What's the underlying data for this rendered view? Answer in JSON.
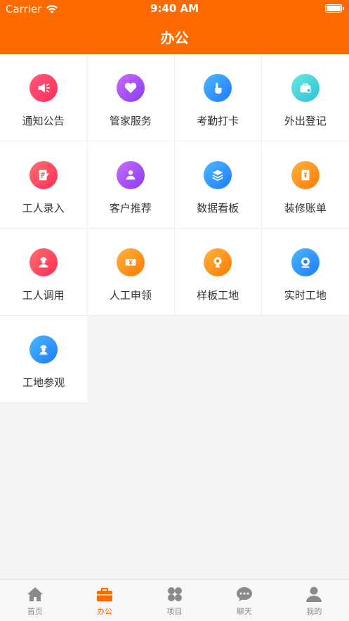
{
  "status": {
    "carrier": "Carrier",
    "time": "9:40 AM"
  },
  "header": {
    "title": "办公"
  },
  "grid": {
    "items": [
      {
        "label": "通知公告",
        "icon": "megaphone-icon",
        "colors": [
          "#ff5b7f",
          "#ff2d55"
        ]
      },
      {
        "label": "管家服务",
        "icon": "heart-icon",
        "colors": [
          "#c86cff",
          "#8a3bf0"
        ]
      },
      {
        "label": "考勤打卡",
        "icon": "tap-hand-icon",
        "colors": [
          "#4ab8ff",
          "#1e7bff"
        ]
      },
      {
        "label": "外出登记",
        "icon": "briefcase-icon",
        "colors": [
          "#66e8df",
          "#2fc1d6"
        ]
      },
      {
        "label": "工人录入",
        "icon": "document-edit-icon",
        "colors": [
          "#ff6f6f",
          "#ff2d55"
        ]
      },
      {
        "label": "客户推荐",
        "icon": "user-badge-icon",
        "colors": [
          "#c86cff",
          "#8a3bf0"
        ]
      },
      {
        "label": "数据看板",
        "icon": "layers-icon",
        "colors": [
          "#4ab8ff",
          "#1e7bff"
        ]
      },
      {
        "label": "装修账单",
        "icon": "bill-book-icon",
        "colors": [
          "#ffb340",
          "#ff7a00"
        ]
      },
      {
        "label": "工人调用",
        "icon": "worker-icon",
        "colors": [
          "#ff6f6f",
          "#ff2d55"
        ]
      },
      {
        "label": "人工申领",
        "icon": "ticket-yen-icon",
        "colors": [
          "#ffb340",
          "#ff7a00"
        ]
      },
      {
        "label": "样板工地",
        "icon": "webcam-icon",
        "colors": [
          "#ffb340",
          "#ff7a00"
        ]
      },
      {
        "label": "实时工地",
        "icon": "camera-icon",
        "colors": [
          "#4ab8ff",
          "#1e7bff"
        ]
      },
      {
        "label": "工地参观",
        "icon": "helmet-worker-icon",
        "colors": [
          "#4ab8ff",
          "#1e7bff"
        ]
      }
    ]
  },
  "tabbar": {
    "items": [
      {
        "label": "首页",
        "icon": "home-icon",
        "active": false
      },
      {
        "label": "办公",
        "icon": "briefcase-icon",
        "active": true
      },
      {
        "label": "项目",
        "icon": "four-leaf-icon",
        "active": false
      },
      {
        "label": "聊天",
        "icon": "chat-bubble-icon",
        "active": false
      },
      {
        "label": "我的",
        "icon": "person-icon",
        "active": false
      }
    ]
  },
  "colors": {
    "brand": "#ff6a00",
    "inactive_tab": "#8a8a8a"
  }
}
